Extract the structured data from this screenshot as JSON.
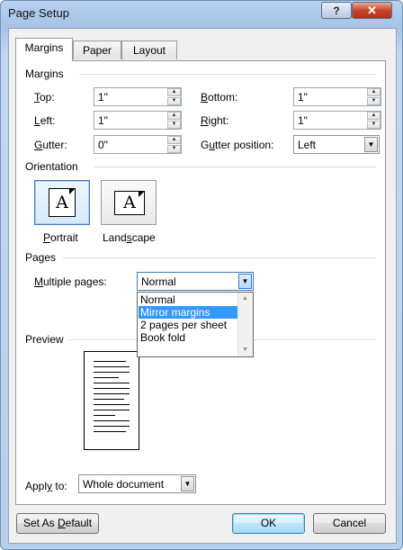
{
  "window": {
    "title": "Page Setup",
    "help_glyph": "?",
    "close_glyph": "✕"
  },
  "tabs": [
    {
      "label": "Margins",
      "active": true
    },
    {
      "label": "Paper",
      "active": false
    },
    {
      "label": "Layout",
      "active": false
    }
  ],
  "margins": {
    "group_label": "Margins",
    "top": {
      "label_u": "T",
      "label_rest": "op:",
      "value": "1\""
    },
    "bottom": {
      "label_u": "B",
      "label_rest": "ottom:",
      "value": "1\""
    },
    "left": {
      "label_u": "L",
      "label_rest": "eft:",
      "value": "1\""
    },
    "right": {
      "label_u": "R",
      "label_rest": "ight:",
      "value": "1\""
    },
    "gutter": {
      "label_u": "G",
      "label_rest": "utter:",
      "value": "0\""
    },
    "gutter_position": {
      "label_pre": "G",
      "label_u": "u",
      "label_rest": "tter position:",
      "value": "Left"
    }
  },
  "orientation": {
    "group_label": "Orientation",
    "portrait": {
      "label_u": "P",
      "label_rest": "ortrait",
      "glyph": "A",
      "selected": true
    },
    "landscape": {
      "label_pre": "Land",
      "label_u": "s",
      "label_rest": "cape",
      "glyph": "A",
      "selected": false
    }
  },
  "pages": {
    "group_label": "Pages",
    "multiple_pages_label_u": "M",
    "multiple_pages_label_rest": "ultiple pages:",
    "multiple_pages_value": "Normal",
    "options": [
      "Normal",
      "Mirror margins",
      "2 pages per sheet",
      "Book fold"
    ],
    "highlighted_option": "Mirror margins"
  },
  "preview": {
    "group_label": "Preview"
  },
  "apply_to": {
    "label_pre": "Appl",
    "label_u": "y",
    "label_rest": " to:",
    "value": "Whole document"
  },
  "buttons": {
    "set_as_default_pre": "Set As ",
    "set_as_default_u": "D",
    "set_as_default_rest": "efault",
    "ok": "OK",
    "cancel": "Cancel"
  },
  "icons": {
    "dropdown": "chevron-down-icon",
    "spin_up": "spin-up-icon",
    "spin_down": "spin-down-icon"
  }
}
